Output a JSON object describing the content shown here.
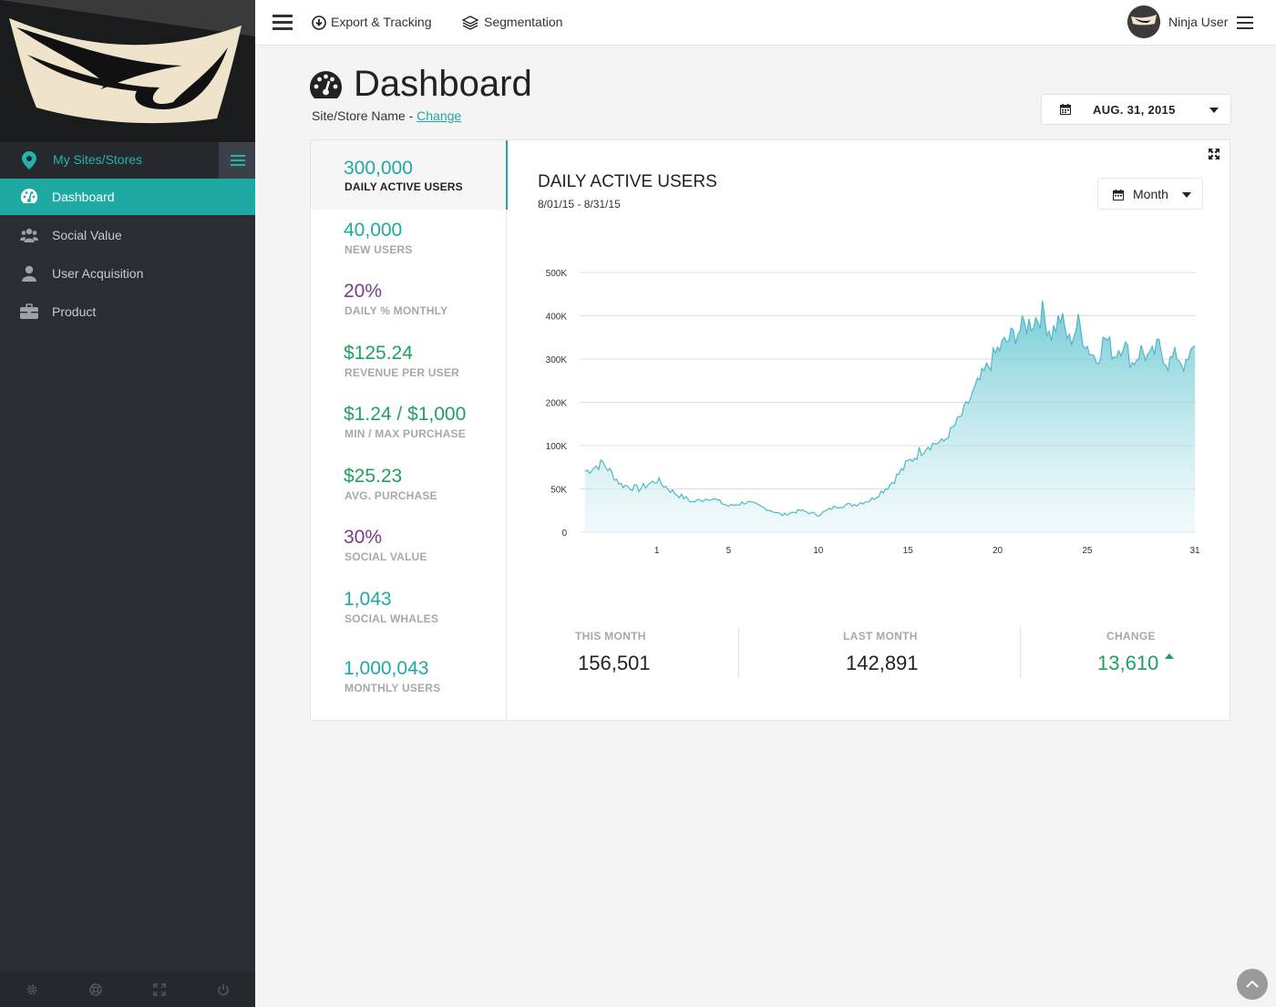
{
  "colors": {
    "accent": "#1fa9a3",
    "green": "#1fa15f",
    "purple": "#7a3c8c",
    "sidebar": "#2a2d33"
  },
  "sidebar": {
    "sites_label": "My Sites/Stores",
    "items": [
      {
        "label": "Dashboard",
        "icon": "dashboard-icon",
        "active": true
      },
      {
        "label": "Social Value",
        "icon": "users-icon",
        "active": false
      },
      {
        "label": "User Acquisition",
        "icon": "user-icon",
        "active": false
      },
      {
        "label": "Product",
        "icon": "briefcase-icon",
        "active": false
      }
    ],
    "footer_icons": [
      "settings-icon",
      "lifebuoy-icon",
      "fullscreen-icon",
      "power-icon"
    ]
  },
  "topbar": {
    "export_label": "Export & Tracking",
    "segmentation_label": "Segmentation",
    "user_name": "Ninja User"
  },
  "header": {
    "title": "Dashboard",
    "site_label": "Site/Store Name - ",
    "change_link": "Change",
    "date": "AUG. 31, 2015"
  },
  "metrics": [
    {
      "value": "300,000",
      "label": "DAILY ACTIVE USERS",
      "color": "teal",
      "selected": true
    },
    {
      "value": "40,000",
      "label": "NEW USERS",
      "color": "teal"
    },
    {
      "value": "20%",
      "label": "DAILY % MONTHLY",
      "color": "purple"
    },
    {
      "value": "$125.24",
      "label": "REVENUE PER USER",
      "color": "green"
    },
    {
      "value": "$1.24 / $1,000",
      "label": "MIN / MAX PURCHASE",
      "color": "green"
    },
    {
      "value": "$25.23",
      "label": "AVG. PURCHASE",
      "color": "green"
    },
    {
      "value": "30%",
      "label": "SOCIAL VALUE",
      "color": "purple"
    },
    {
      "value": "1,043",
      "label": "SOCIAL WHALES",
      "color": "teal"
    },
    {
      "value": "1,000,043",
      "label": "MONTHLY USERS",
      "color": "teal"
    }
  ],
  "chart": {
    "title": "DAILY ACTIVE USERS",
    "range": "8/01/15 - 8/31/15",
    "period": "Month"
  },
  "chart_data": {
    "type": "area",
    "y_ticks": [
      "0",
      "50K",
      "100K",
      "200K",
      "300K",
      "400K",
      "500K"
    ],
    "x_ticks": [
      "1",
      "5",
      "10",
      "15",
      "20",
      "25",
      "31"
    ],
    "x": [
      -3,
      -2,
      -1,
      0,
      1,
      2,
      3,
      4,
      5,
      6,
      7,
      8,
      9,
      10,
      11,
      12,
      13,
      14,
      15,
      16,
      17,
      18,
      19,
      20,
      21,
      22,
      22.5,
      23,
      23.5,
      24,
      24.5,
      25,
      25.5,
      26,
      26.5,
      27,
      27.5,
      28,
      28.5,
      29,
      29.5,
      30,
      30.5,
      31
    ],
    "y": [
      70000,
      80000,
      55000,
      50000,
      60000,
      45000,
      35000,
      40000,
      30000,
      35000,
      28000,
      20000,
      25000,
      20000,
      30000,
      32000,
      38000,
      55000,
      80000,
      100000,
      110000,
      170000,
      250000,
      320000,
      360000,
      390000,
      405000,
      360000,
      395000,
      340000,
      380000,
      330000,
      300000,
      350000,
      310000,
      340000,
      290000,
      320000,
      300000,
      330000,
      290000,
      310000,
      280000,
      330000
    ],
    "ylim": [
      0,
      500000
    ]
  },
  "stats": {
    "this_month_label": "THIS MONTH",
    "this_month_value": "156,501",
    "last_month_label": "LAST MONTH",
    "last_month_value": "142,891",
    "change_label": "CHANGE",
    "change_value": "13,610"
  }
}
